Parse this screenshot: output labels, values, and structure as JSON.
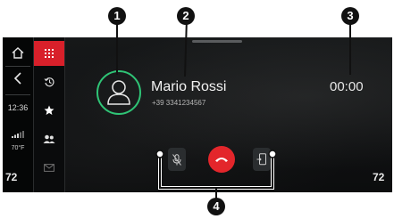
{
  "system_bar": {
    "clock": "12:36",
    "temperature": "70°F",
    "temperature_sub": " ",
    "seat_left": "72",
    "seat_right": "72"
  },
  "phone_menu": {
    "items": [
      {
        "icon": "keypad-icon",
        "active": true
      },
      {
        "icon": "recent-calls-icon",
        "active": false
      },
      {
        "icon": "favorites-star-icon",
        "active": false
      },
      {
        "icon": "contacts-icon",
        "active": false
      },
      {
        "icon": "messages-icon",
        "active": false
      }
    ]
  },
  "call": {
    "contact_name": "Mario Rossi",
    "contact_number": "+39 3341234567",
    "timer": "00:00"
  },
  "controls": {
    "mute_icon": "mute-microphone-icon",
    "end_icon": "end-call-icon",
    "transfer_icon": "transfer-to-phone-icon",
    "end_color": "#e3262b",
    "accent_color": "#2fc476"
  },
  "callouts": {
    "c1": "1",
    "c2": "2",
    "c3": "3",
    "c4": "4"
  }
}
